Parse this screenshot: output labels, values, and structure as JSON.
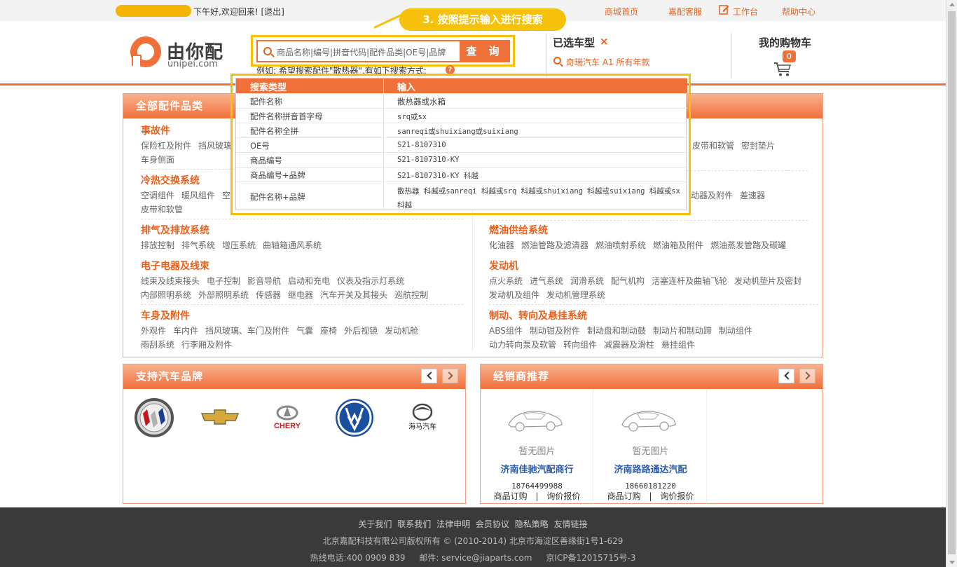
{
  "topbar": {
    "greeting": "下午好,欢迎回来!",
    "logout": "[退出]",
    "links": [
      "商城首页",
      "嘉配客服",
      "工作台",
      "帮助中心"
    ]
  },
  "callout": "3. 按照提示输入进行搜索",
  "logo": {
    "name": "由你配",
    "sub": "unipei.com"
  },
  "search": {
    "placeholder": "商品名称|编号|拼音代码|配件品类|OE号|品牌",
    "button": "查 询",
    "example": "例如: 希望搜索配件\"散热器\",有如下搜索方式:",
    "help": "?"
  },
  "car": {
    "title": "已选车型",
    "remove": "×",
    "selected": "奇瑞汽车 A1 所有年款"
  },
  "cart": {
    "title": "我的购物车",
    "count": "0"
  },
  "categories": {
    "title": "全部配件品类",
    "groups": [
      {
        "title": "事故件",
        "items": [
          "保险杠及附件",
          "挡风玻璃",
          "车身侧面"
        ]
      },
      {
        "title": "冷热交换系统",
        "items": [
          "空调组件",
          "暖风组件",
          "空",
          "皮带和软管"
        ]
      },
      {
        "title": "排气及排放系统",
        "items": [
          "排放控制",
          "排气系统",
          "增压系统",
          "曲轴箱通风系统"
        ]
      },
      {
        "title": "电子电器及线束",
        "items": [
          "线束及线束接头",
          "电子控制",
          "影音导航",
          "启动和充电",
          "仪表及指示灯系统",
          "内部照明系统",
          "外部照明系统",
          "传感器",
          "继电器",
          "汽车开关及其接头",
          "巡航控制"
        ]
      },
      {
        "title": "车身及附件",
        "items": [
          "外观件",
          "车内件",
          "挡风玻璃、车门及附件",
          "气囊",
          "座椅",
          "外后视镜",
          "发动机舱",
          "雨刮系统",
          "行李厢及附件"
        ]
      }
    ],
    "right_groups": [
      {
        "title": "",
        "items": [
          "皮带和软管",
          "密封垫片"
        ]
      },
      {
        "title": "",
        "items": [
          "动器及附件",
          "差速器"
        ]
      },
      {
        "title": "燃油供给系统",
        "items": [
          "化油器",
          "燃油管路及滤清器",
          "燃油喷射系统",
          "燃油箱及附件",
          "燃油蒸发管路及碳罐"
        ]
      },
      {
        "title": "发动机",
        "items": [
          "点火系统",
          "进气系统",
          "润滑系统",
          "配气机构",
          "活塞连杆及曲轴飞轮",
          "发动机垫片及密封",
          "发动机及组件",
          "发动机管理系统"
        ]
      },
      {
        "title": "制动、转向及悬挂系统",
        "items": [
          "ABS组件",
          "制动钳及附件",
          "制动盘和制动鼓",
          "制动片和制动蹄",
          "制动组件",
          "动力转向泵及软管",
          "转向组件",
          "减震器及滑柱",
          "悬挂组件"
        ]
      }
    ]
  },
  "tip_table": {
    "headers": [
      "搜索类型",
      "输入"
    ],
    "rows": [
      [
        "配件名称",
        "散热器或水箱"
      ],
      [
        "配件名称拼音首字母",
        "srq或sx"
      ],
      [
        "配件名称全拼",
        "sanreqi或shuixiang或suixiang"
      ],
      [
        "OE号",
        "S21-8107310"
      ],
      [
        "商品编号",
        "S21-8107310-KY"
      ],
      [
        "商品编号+品牌",
        "S21-8107310-KY 科越"
      ],
      [
        "配件名称+品牌",
        "散热器 科越或sanreqi 科越或srq 科越或shuixiang 科越或suixiang 科越或sx 科越"
      ]
    ]
  },
  "brands": {
    "title": "支持汽车品牌",
    "logos": [
      "buick-logo",
      "chevrolet-logo",
      "chery-logo",
      "volkswagen-logo",
      "haima-logo"
    ],
    "chery_text": "CHERY",
    "haima_text": "海马汽车"
  },
  "dealers": {
    "title": "经销商推荐",
    "cards": [
      {
        "noimg": "暂无图片",
        "name": "济南佳驰汽配商行",
        "phone": "18764499988",
        "order": "商品订购",
        "sep": "|",
        "quote": "询价报价"
      },
      {
        "noimg": "暂无图片",
        "name": "济南路路通达汽配",
        "phone": "18660181220",
        "order": "商品订购",
        "sep": "|",
        "quote": "询价报价"
      }
    ]
  },
  "footer": {
    "links": [
      "关于我们",
      "联系我们",
      "法律申明",
      "会员协议",
      "隐私策略",
      "友情链接"
    ],
    "copyright": "北京嘉配科技有限公司版权所有 © (2010-2014) 北京市海淀区善缘街1号1-629",
    "hotline": "热线电话:400 0909 839",
    "email": "邮件: service@jiaparts.com",
    "icp": "京ICP备12015715号-3"
  },
  "colors": {
    "accent": "#f0703a",
    "highlight": "#f5c10a",
    "link_blue": "#2a5ba8"
  }
}
